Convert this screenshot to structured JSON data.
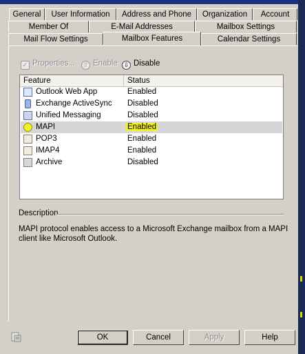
{
  "tabs_row1": [
    "General",
    "User Information",
    "Address and Phone",
    "Organization",
    "Account"
  ],
  "tabs_row2": [
    "Member Of",
    "E-Mail Addresses",
    "Mailbox Settings"
  ],
  "tabs_row3": [
    "Mail Flow Settings",
    "Mailbox Features",
    "Calendar Settings"
  ],
  "active_tab": "Mailbox Features",
  "toolbar": {
    "properties_label": "Properties...",
    "enable_label": "Enable",
    "disable_label": "Disable"
  },
  "list": {
    "col_feature": "Feature",
    "col_status": "Status",
    "items": [
      {
        "name": "Outlook Web App",
        "status": "Enabled",
        "icon": "outlook-web-app-icon"
      },
      {
        "name": "Exchange ActiveSync",
        "status": "Disabled",
        "icon": "activesync-phone-icon"
      },
      {
        "name": "Unified Messaging",
        "status": "Disabled",
        "icon": "unified-messaging-icon"
      },
      {
        "name": "MAPI",
        "status": "Enabled",
        "icon": "mapi-icon"
      },
      {
        "name": "POP3",
        "status": "Enabled",
        "icon": "pop3-icon"
      },
      {
        "name": "IMAP4",
        "status": "Enabled",
        "icon": "imap4-icon"
      },
      {
        "name": "Archive",
        "status": "Disabled",
        "icon": "archive-icon"
      }
    ],
    "selected_index": 3
  },
  "description": {
    "label": "Description",
    "text": "MAPI protocol enables access to a Microsoft Exchange mailbox from a MAPI client like Microsoft Outlook."
  },
  "buttons": {
    "ok": "OK",
    "cancel": "Cancel",
    "apply": "Apply",
    "help": "Help"
  },
  "colors": {
    "dialog_bg": "#d4d0c8",
    "highlight": "#f3f12c",
    "selection": "#d6d6d6"
  }
}
